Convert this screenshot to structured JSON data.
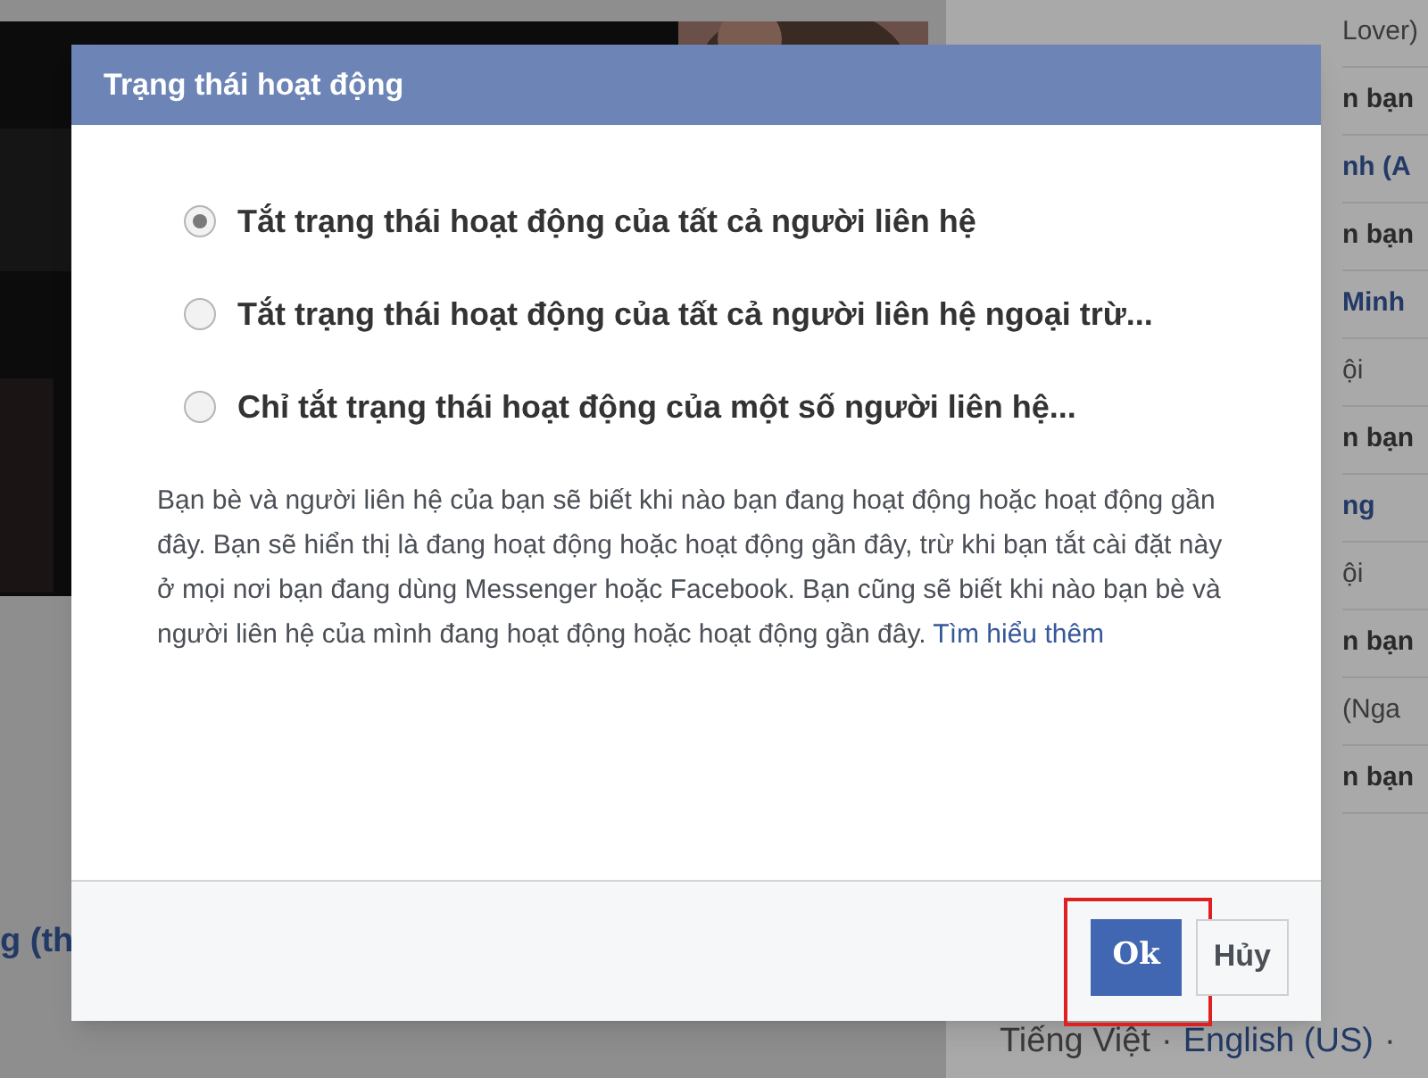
{
  "background": {
    "side_texts": [
      {
        "text": "Lover)",
        "kind": "plain"
      },
      {
        "text": "n bạn",
        "kind": "bold"
      },
      {
        "text": "nh (A",
        "kind": "link"
      },
      {
        "text": "n bạn",
        "kind": "bold"
      },
      {
        "text": "Minh",
        "kind": "link"
      },
      {
        "text": "ội",
        "kind": "plain"
      },
      {
        "text": "n bạn",
        "kind": "bold"
      },
      {
        "text": "ng",
        "kind": "link"
      },
      {
        "text": "ội",
        "kind": "plain"
      },
      {
        "text": "n bạn",
        "kind": "bold"
      },
      {
        "text": "(Nga",
        "kind": "plain"
      },
      {
        "text": "n bạn",
        "kind": "bold"
      }
    ],
    "left_link": "g (th",
    "languages": [
      "Tiếng Việt",
      "·",
      "English (US)",
      "·"
    ]
  },
  "dialog": {
    "title": "Trạng thái hoạt động",
    "options": [
      {
        "label": "Tắt trạng thái hoạt động của tất cả người liên hệ",
        "selected": true
      },
      {
        "label": "Tắt trạng thái hoạt động của tất cả người liên hệ ngoại trừ...",
        "selected": false
      },
      {
        "label": "Chỉ tắt trạng thái hoạt động của một số người liên hệ...",
        "selected": false
      }
    ],
    "description": "Bạn bè và người liên hệ của bạn sẽ biết khi nào bạn đang hoạt động hoặc hoạt động gần đây. Bạn sẽ hiển thị là đang hoạt động hoặc hoạt động gần đây, trừ khi bạn tắt cài đặt này ở mọi nơi bạn đang dùng Messenger hoặc Facebook. Bạn cũng sẽ biết khi nào bạn bè và người liên hệ của mình đang hoạt động hoặc hoạt động gần đây.",
    "learn_more": "Tìm hiểu thêm",
    "buttons": [
      {
        "label": "Ok",
        "kind": "primary",
        "highlighted": true
      },
      {
        "label": "Hủy",
        "kind": "secondary",
        "highlighted": false
      }
    ]
  }
}
